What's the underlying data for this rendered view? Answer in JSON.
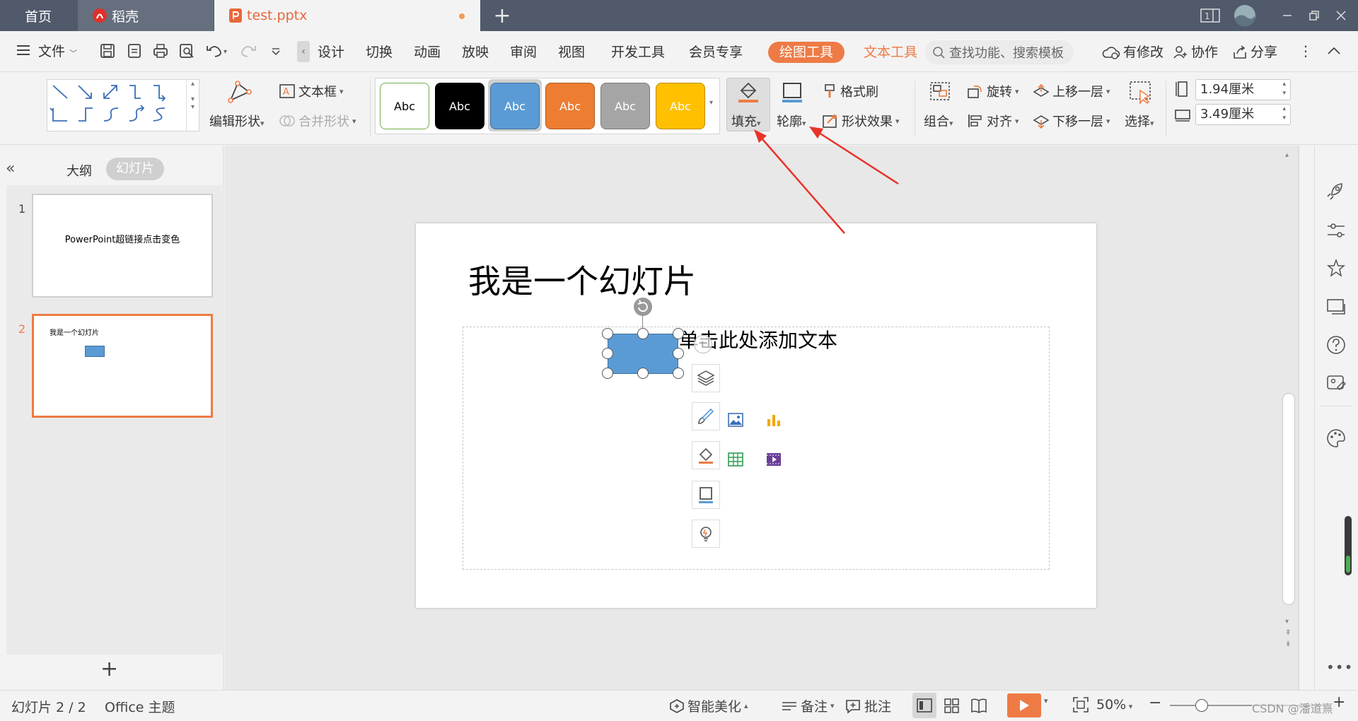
{
  "tabs": {
    "home": "首页",
    "daoke": "稻壳",
    "doc": "test.pptx",
    "new": "+"
  },
  "menu": {
    "file": "文件",
    "items": [
      "设计",
      "切换",
      "动画",
      "放映",
      "审阅",
      "视图",
      "开发工具",
      "会员专享"
    ],
    "draw_tools": "绘图工具",
    "text_tools": "文本工具",
    "search_placeholder": "查找功能、搜索模板",
    "modified": "有修改",
    "collab": "协作",
    "share": "分享"
  },
  "ribbon": {
    "edit_shape": "编辑形状",
    "textbox": "文本框",
    "merge_shape": "合并形状",
    "style_label": "Abc",
    "fill": "填充",
    "outline": "轮廓",
    "format_painter": "格式刷",
    "shape_effects": "形状效果",
    "group": "组合",
    "rotate": "旋转",
    "align": "对齐",
    "bring_forward": "上移一层",
    "send_backward": "下移一层",
    "select": "选择",
    "height": "1.94厘米",
    "width": "3.49厘米"
  },
  "style_colors": [
    "#ffffff",
    "#000000",
    "#5b9bd5",
    "#ed7d31",
    "#a5a5a5",
    "#ffc000"
  ],
  "leftpane": {
    "outline_tab": "大纲",
    "slides_tab": "幻灯片",
    "slides": [
      {
        "number": "1",
        "text": "PowerPoint超链接点击变色"
      },
      {
        "number": "2",
        "text": "我是一个幻灯片"
      }
    ],
    "add": "+"
  },
  "slide": {
    "title": "我是一个幻灯片",
    "placeholder": "单击此处添加文本"
  },
  "statusbar": {
    "slide_count": "幻灯片 2 / 2",
    "theme": "Office 主题",
    "smart_beautify": "智能美化",
    "notes": "备注",
    "comments": "批注",
    "zoom": "50%",
    "watermark": "CSDN @潘道熹"
  },
  "accent_color": "#ee7b45",
  "selected_shape_color": "#5b9bd5",
  "arrow_color": "#e8332a"
}
